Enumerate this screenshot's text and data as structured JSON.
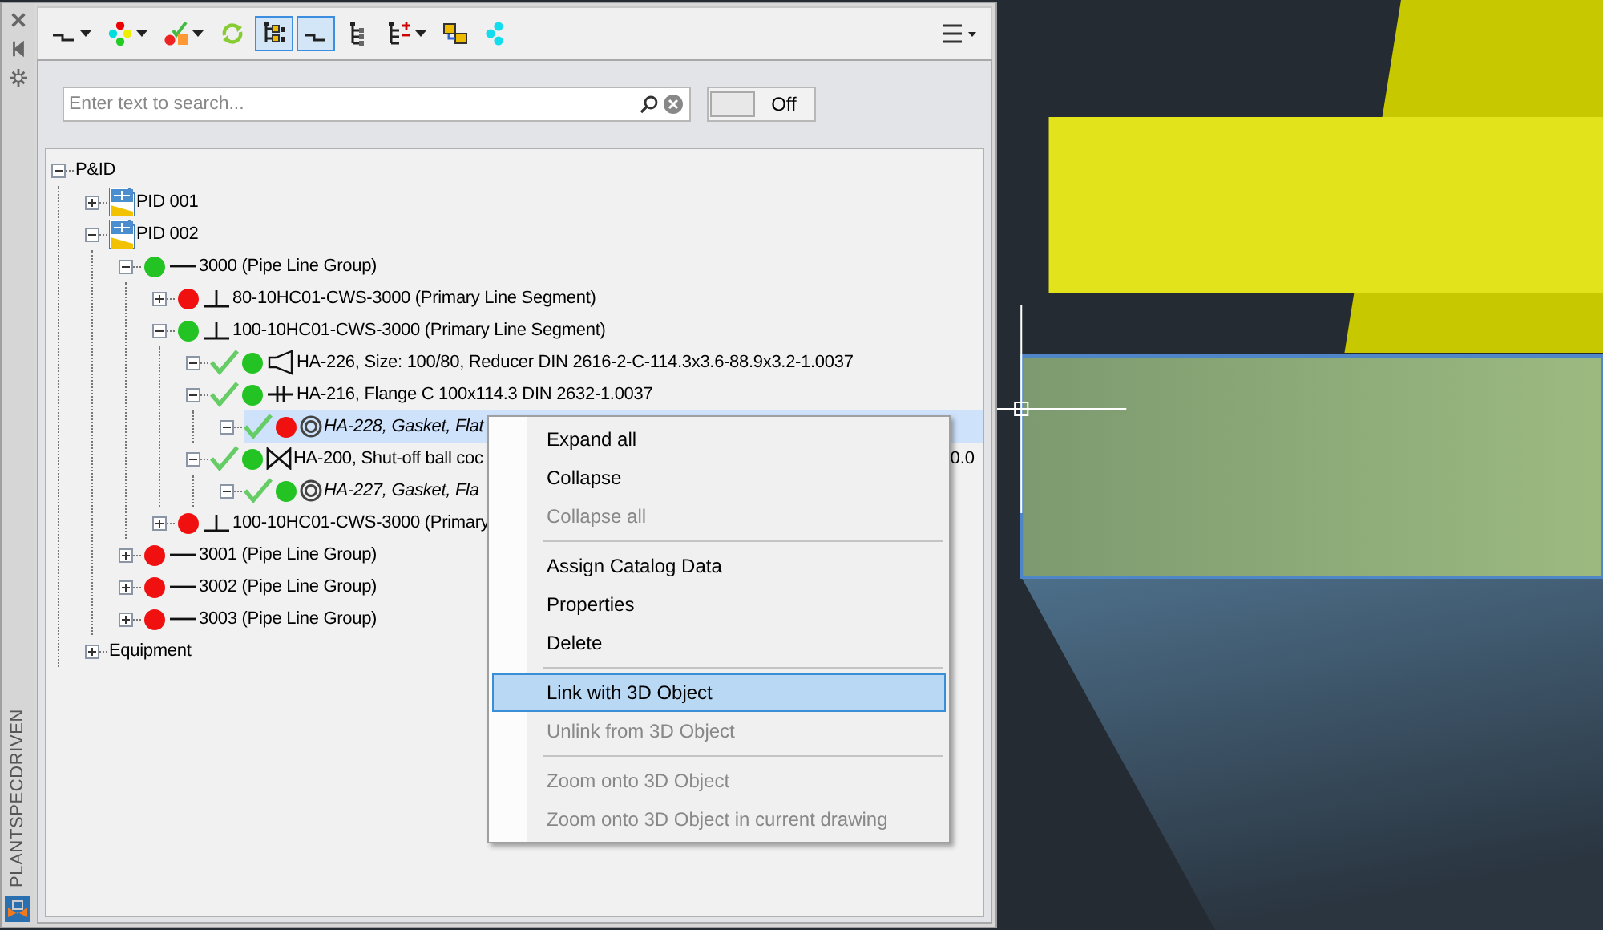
{
  "palette": {
    "side_label": "PLANTSPECDRIVEN"
  },
  "toolbar": [
    {
      "kind": "line",
      "pressed": false,
      "dropdown": true
    },
    {
      "kind": "dots",
      "pressed": false,
      "dropdown": true
    },
    {
      "kind": "checkdots",
      "pressed": false,
      "dropdown": true
    },
    {
      "kind": "refresh",
      "pressed": false,
      "dropdown": false
    },
    {
      "kind": "treelink",
      "pressed": true,
      "dropdown": false
    },
    {
      "kind": "line",
      "pressed": true,
      "dropdown": false
    },
    {
      "kind": "tree",
      "pressed": false,
      "dropdown": false
    },
    {
      "kind": "treeplus",
      "pressed": false,
      "dropdown": true
    },
    {
      "kind": "link",
      "pressed": false,
      "dropdown": false
    },
    {
      "kind": "cyandots",
      "pressed": false,
      "dropdown": false
    }
  ],
  "search": {
    "placeholder": "Enter text to search..."
  },
  "toggle": {
    "label": "Off",
    "on": false
  },
  "tree": [
    {
      "text": "P&ID",
      "expanded": true,
      "selected": false,
      "children": [
        {
          "text": "PID 001",
          "kind": "drawing",
          "expanded": false,
          "selected": false
        },
        {
          "text": "PID 002",
          "kind": "drawing",
          "expanded": true,
          "selected": false,
          "children": [
            {
              "text": "3000 (Pipe Line Group)",
              "kind": "line",
              "color": "#22c322",
              "expanded": true,
              "selected": false,
              "children": [
                {
                  "text": "80-10HC01-CWS-3000 (Primary Line Segment)",
                  "kind": "tee",
                  "color": "#f01010",
                  "expanded": false,
                  "selected": false
                },
                {
                  "text": "100-10HC01-CWS-3000 (Primary Line Segment)",
                  "kind": "tee",
                  "color": "#22c322",
                  "expanded": true,
                  "selected": false,
                  "children": [
                    {
                      "text": "HA-226, Size: 100/80, Reducer DIN 2616-2-C-114.3x3.6-88.9x3.2-1.0037",
                      "kind": "reducer",
                      "checked": true,
                      "color": "#22c322",
                      "expanded": true,
                      "selected": false
                    },
                    {
                      "text": "HA-216, Flange C 100x114.3 DIN 2632-1.0037",
                      "kind": "flange",
                      "checked": true,
                      "color": "#22c322",
                      "expanded": true,
                      "selected": false,
                      "children": [
                        {
                          "text": "HA-228, Gasket, Flat",
                          "kind": "gasket",
                          "checked": true,
                          "color": "#f01010",
                          "expanded": true,
                          "selected": true
                        }
                      ]
                    },
                    {
                      "text": "HA-200, Shut-off ball coc",
                      "tail": "0.0",
                      "kind": "valve",
                      "checked": true,
                      "color": "#22c322",
                      "expanded": true,
                      "selected": false,
                      "children": [
                        {
                          "text": "HA-227, Gasket, Fla",
                          "kind": "gasket",
                          "checked": true,
                          "color": "#22c322",
                          "expanded": true,
                          "selected": false
                        }
                      ]
                    }
                  ]
                },
                {
                  "text": "100-10HC01-CWS-3000 (Primary",
                  "kind": "tee",
                  "color": "#f01010",
                  "expanded": false,
                  "selected": false
                }
              ]
            },
            {
              "text": "3001 (Pipe Line Group)",
              "kind": "line",
              "color": "#f01010",
              "expanded": false,
              "selected": false
            },
            {
              "text": "3002 (Pipe Line Group)",
              "kind": "line",
              "color": "#f01010",
              "expanded": false,
              "selected": false
            },
            {
              "text": "3003 (Pipe Line Group)",
              "kind": "line",
              "color": "#f01010",
              "expanded": false,
              "selected": false
            }
          ]
        },
        {
          "text": "Equipment",
          "expanded": false,
          "selected": false
        }
      ]
    }
  ],
  "context_menu": [
    {
      "kind": "item",
      "label": "Expand all",
      "disabled": false,
      "selected": false
    },
    {
      "kind": "item",
      "label": "Collapse",
      "disabled": false,
      "selected": false
    },
    {
      "kind": "item",
      "label": "Collapse all",
      "disabled": true,
      "selected": false
    },
    {
      "kind": "separator"
    },
    {
      "kind": "item",
      "label": "Assign Catalog Data",
      "disabled": false,
      "selected": false
    },
    {
      "kind": "item",
      "label": "Properties",
      "disabled": false,
      "selected": false
    },
    {
      "kind": "item",
      "label": "Delete",
      "disabled": false,
      "selected": false
    },
    {
      "kind": "separator"
    },
    {
      "kind": "item",
      "label": "Link with 3D Object",
      "disabled": false,
      "selected": true
    },
    {
      "kind": "item",
      "label": "Unlink from 3D Object",
      "disabled": true,
      "selected": false
    },
    {
      "kind": "separator"
    },
    {
      "kind": "item",
      "label": "Zoom onto 3D Object",
      "disabled": true,
      "selected": false
    },
    {
      "kind": "item",
      "label": "Zoom onto 3D Object in current drawing",
      "disabled": true,
      "selected": false
    }
  ]
}
